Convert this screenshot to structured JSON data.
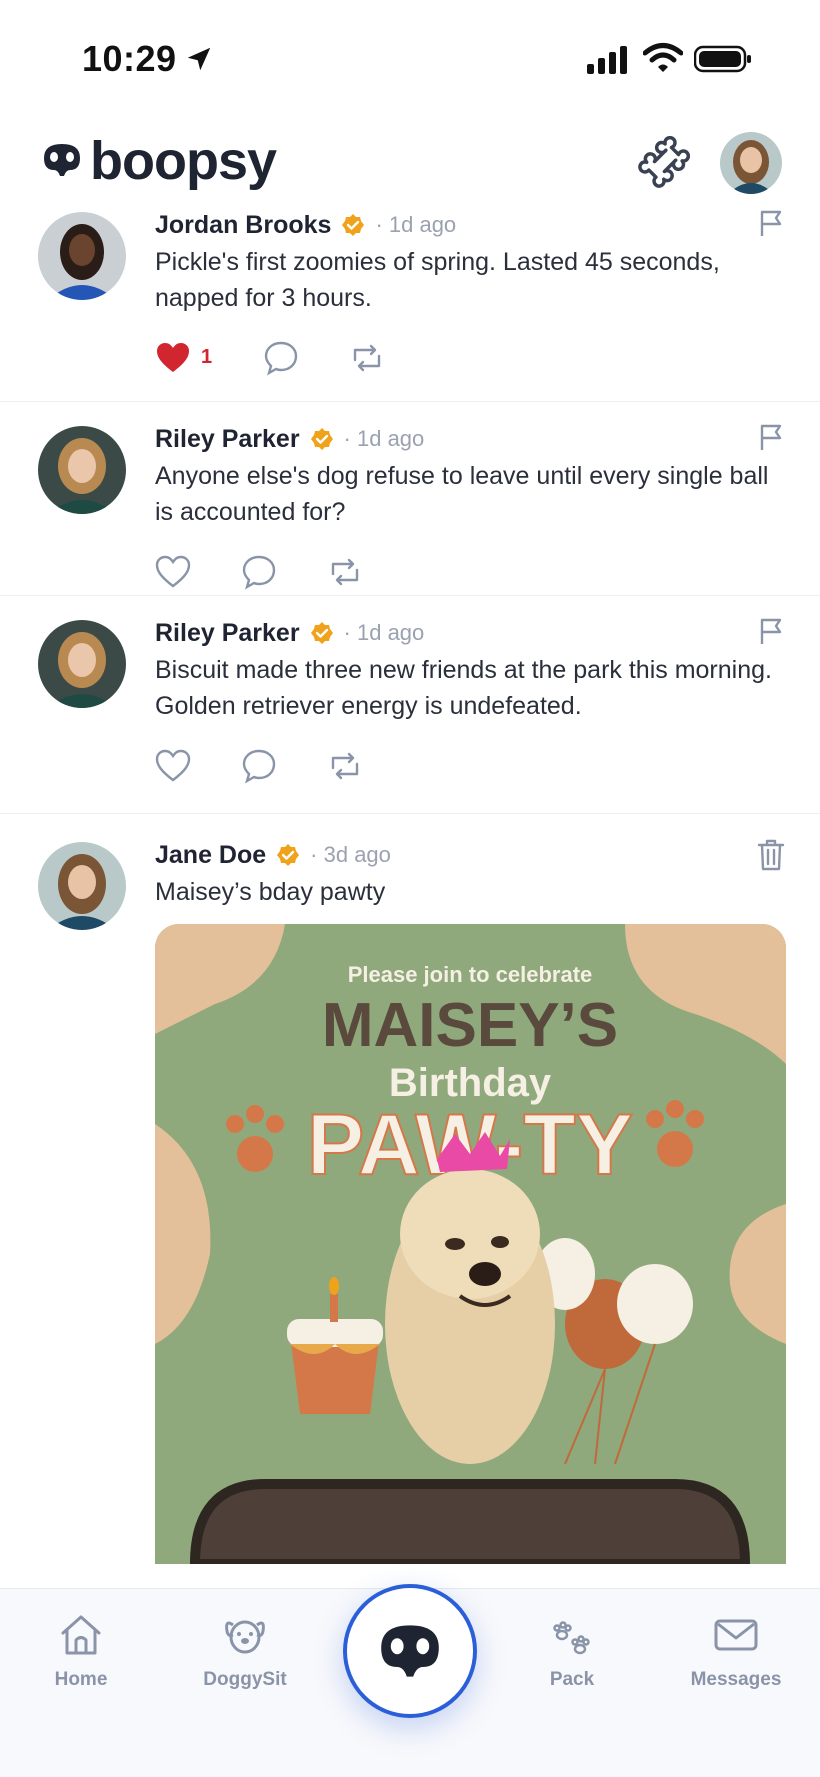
{
  "status_bar": {
    "time": "10:29"
  },
  "app": {
    "name": "boopsy"
  },
  "posts": [
    {
      "author": "Jordan Brooks",
      "time": "· 1d ago",
      "text": "Pickle's first zoomies of spring. Lasted 45 seconds, napped for 3 hours.",
      "likes": "1",
      "liked": true,
      "own": false
    },
    {
      "author": "Riley Parker",
      "time": "· 1d ago",
      "text": "Anyone else's dog refuse to leave until every single ball is accounted for?",
      "liked": false,
      "own": false
    },
    {
      "author": "Riley Parker",
      "time": "· 1d ago",
      "text": "Biscuit made three new friends at the park this morning. Golden retriever energy is undefeated.",
      "liked": false,
      "own": false
    },
    {
      "author": "Jane Doe",
      "time": "· 3d ago",
      "text": "Maisey’s bday pawty",
      "own": true,
      "image": {
        "line1": "Please join to celebrate",
        "line2": "MAISEY’S",
        "line3": "Birthday",
        "line4": "PAW-TY"
      }
    }
  ],
  "nav": {
    "home": "Home",
    "doggysit": "DoggySit",
    "pack": "Pack",
    "messages": "Messages"
  },
  "colors": {
    "verified": "#f0a21a",
    "like": "#d1262f",
    "accent": "#2b5fd9",
    "card_green": "#8fa97c",
    "card_tan": "#e3c09a"
  }
}
